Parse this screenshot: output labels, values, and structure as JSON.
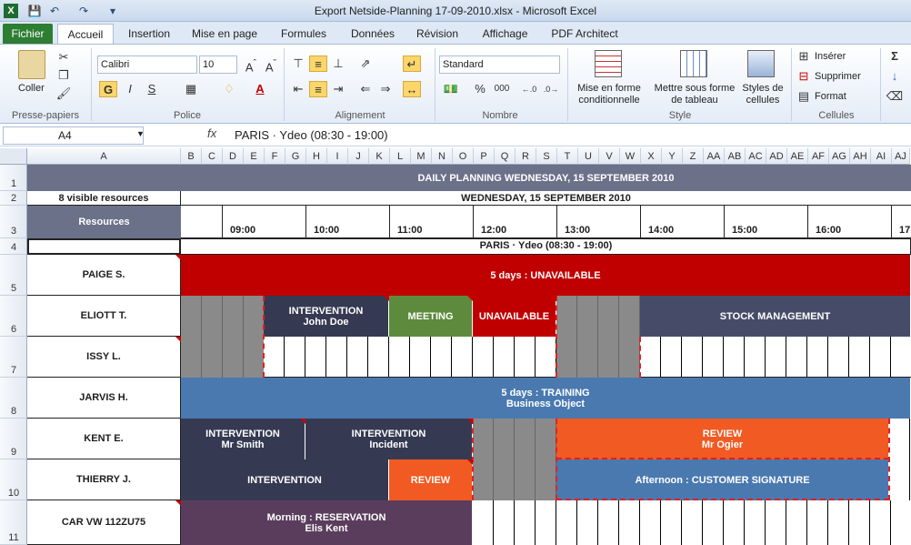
{
  "window": {
    "title": "Export Netside-Planning 17-09-2010.xlsx - Microsoft Excel",
    "quick_access": [
      "save-icon",
      "undo-icon",
      "redo-icon"
    ]
  },
  "ribbon": {
    "tabs": [
      "Fichier",
      "Accueil",
      "Insertion",
      "Mise en page",
      "Formules",
      "Données",
      "Révision",
      "Affichage",
      "PDF Architect"
    ],
    "active_tab": "Accueil",
    "clipboard": {
      "paste": "Coller",
      "label": "Presse-papiers"
    },
    "font": {
      "name": "Calibri",
      "size": "10",
      "bold": "G",
      "italic": "I",
      "underline": "S",
      "label": "Police"
    },
    "alignment": {
      "label": "Alignement"
    },
    "number": {
      "format": "Standard",
      "percent": "%",
      "thousands": "000",
      "label": "Nombre"
    },
    "style": {
      "conditional": "Mise en forme conditionnelle",
      "table": "Mettre sous forme de tableau",
      "cell_styles": "Styles de cellules",
      "label": "Style"
    },
    "cells": {
      "insert": "Insérer",
      "delete": "Supprimer",
      "format": "Format",
      "label": "Cellules"
    },
    "sigma": "Σ"
  },
  "formula_bar": {
    "name_box": "A4",
    "fx": "fx",
    "content": "PARIS · Ydeo  (08:30 - 19:00)"
  },
  "columns": [
    "A",
    "B",
    "C",
    "D",
    "E",
    "F",
    "G",
    "H",
    "I",
    "J",
    "K",
    "L",
    "M",
    "N",
    "O",
    "P",
    "Q",
    "R",
    "S",
    "T",
    "U",
    "V",
    "W",
    "X",
    "Y",
    "Z",
    "AA",
    "AB",
    "AC",
    "AD",
    "AE",
    "AF",
    "AG",
    "AH",
    "AI",
    "AJ"
  ],
  "rows": [
    "1",
    "2",
    "3",
    "4",
    "5",
    "6",
    "7",
    "8",
    "9",
    "10",
    "11"
  ],
  "sheet": {
    "title": "DAILY PLANNING WEDNESDAY, 15 SEPTEMBER 2010",
    "visible_resources": "8 visible resources",
    "date_header": "WEDNESDAY, 15 SEPTEMBER 2010",
    "resources_header": "Resources",
    "hours": [
      "09:00",
      "10:00",
      "11:00",
      "12:00",
      "13:00",
      "14:00",
      "15:00",
      "16:00",
      "17"
    ],
    "site": "PARIS · Ydeo  (08:30 - 19:00)",
    "resources": [
      "PAIGE S.",
      "ELIOTT T.",
      "ISSY L.",
      "JARVIS H.",
      "KENT E.",
      "THIERRY J.",
      "CAR VW 112ZU75"
    ],
    "blocks": {
      "paige": "5 days : UNAVAILABLE",
      "eliott_int": [
        "INTERVENTION",
        "John Doe"
      ],
      "eliott_meeting": "MEETING",
      "eliott_unavail": "UNAVAILABLE",
      "eliott_stock": "STOCK MANAGEMENT",
      "jarvis": [
        "5 days : TRAINING",
        "Business Object"
      ],
      "kent_int1": [
        "INTERVENTION",
        "Mr Smith"
      ],
      "kent_int2": [
        "INTERVENTION",
        "Incident"
      ],
      "kent_review": [
        "REVIEW",
        "Mr Ogier"
      ],
      "thierry_int": "INTERVENTION",
      "thierry_review": "REVIEW",
      "thierry_afternoon": "Afternoon : CUSTOMER SIGNATURE",
      "car": [
        "Morning : RESERVATION",
        "Elis Kent"
      ]
    },
    "colors": {
      "header": "#6b7189",
      "unavailable": "#c00000",
      "dark": "#353a52",
      "meeting": "#5d8a3c",
      "stock": "#464c68",
      "training": "#4a79b0",
      "review": "#f15a22",
      "reservation": "#5a3d5c"
    }
  }
}
